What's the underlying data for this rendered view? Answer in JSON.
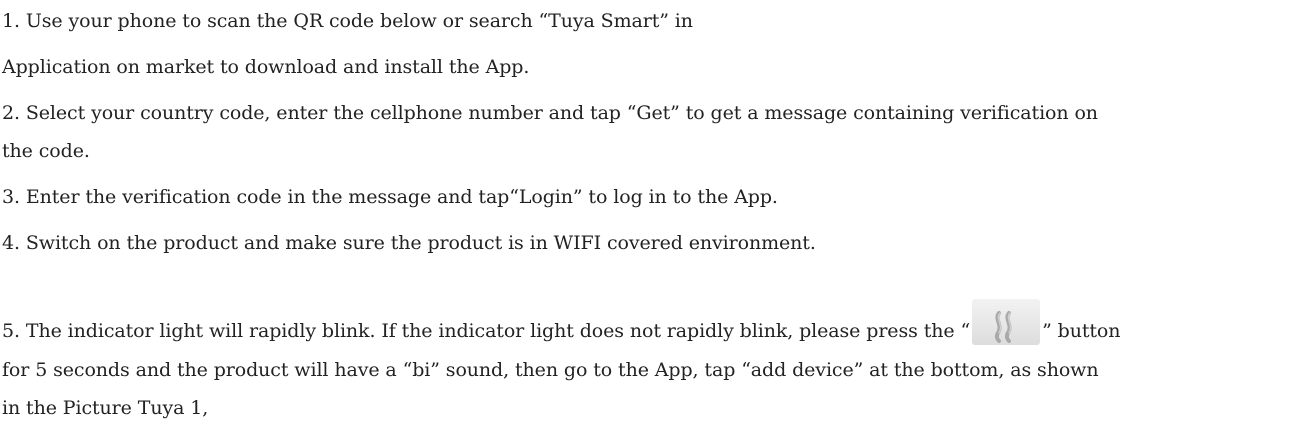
{
  "doc": {
    "step1_line1": "1. Use your phone to scan the QR code below or search “Tuya Smart” in",
    "step1_line2": "Application on market to download and install the App.",
    "step2_line1": "2. Select your country code, enter the cellphone number and tap “Get” to get a message containing verification on",
    "step2_line2": "the code.",
    "step3": "3. Enter the verification code in the message and tap“Login” to log in to the App.",
    "step4": "4. Switch on the product and make sure the product is in WIFI covered environment.",
    "step5_before_icon": "5. The indicator light will rapidly blink. If the indicator light does not rapidly blink, please press the “",
    "step5_after_icon": "” button",
    "step5_line2": "for 5 seconds and the product will have a “bi” sound, then go to the App, tap “add device” at the bottom, as shown",
    "step5_line3": "in the Picture Tuya 1,",
    "button_icon": "steam-button-icon"
  }
}
